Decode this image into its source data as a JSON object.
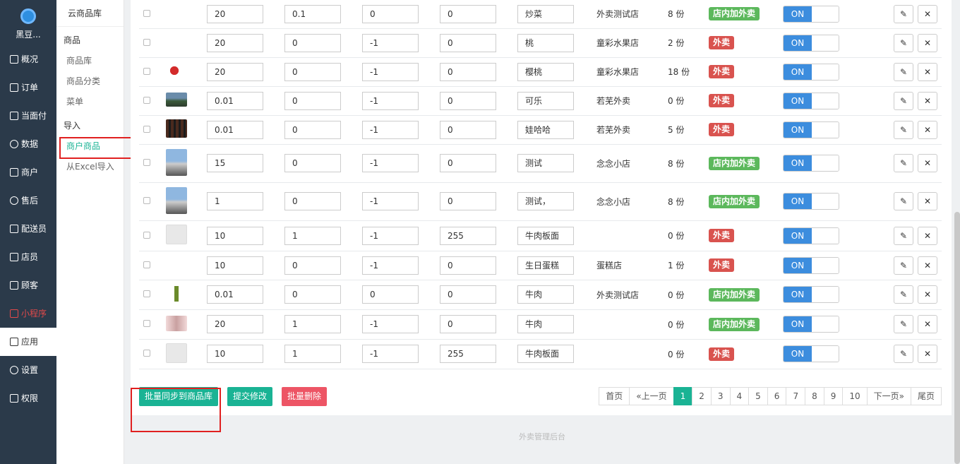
{
  "app": {
    "logo_text": "黑豆..."
  },
  "nav": [
    {
      "label": "概况",
      "icon": "dashboard-icon"
    },
    {
      "label": "订单",
      "icon": "order-icon"
    },
    {
      "label": "当面付",
      "icon": "pay-icon"
    },
    {
      "label": "数据",
      "icon": "data-icon"
    },
    {
      "label": "商户",
      "icon": "store-icon"
    },
    {
      "label": "售后",
      "icon": "aftersale-icon"
    },
    {
      "label": "配送员",
      "icon": "courier-icon"
    },
    {
      "label": "店员",
      "icon": "clerk-icon"
    },
    {
      "label": "顾客",
      "icon": "customer-icon"
    },
    {
      "label": "小程序",
      "icon": "miniprogram-icon"
    },
    {
      "label": "应用",
      "icon": "apps-icon"
    },
    {
      "label": "设置",
      "icon": "settings-icon"
    },
    {
      "label": "权限",
      "icon": "lock-icon"
    }
  ],
  "subnav": {
    "head": "云商品库",
    "group1": "商品",
    "items1": [
      "商品库",
      "商品分类",
      "菜单"
    ],
    "group2": "导入",
    "items2": [
      "商户商品",
      "从Excel导入"
    ]
  },
  "rows": [
    {
      "thumb": "",
      "v1": "20",
      "v2": "0.1",
      "v3": "0",
      "v4": "0",
      "name": "炒菜",
      "store": "外卖测试店",
      "qty": "8 份",
      "tag": "店内加外卖",
      "toggle": "ON"
    },
    {
      "thumb": "",
      "v1": "20",
      "v2": "0",
      "v3": "-1",
      "v4": "0",
      "name": "桃",
      "store": "童彩水果店",
      "qty": "2 份",
      "tag": "外卖",
      "toggle": "ON"
    },
    {
      "thumb": "cherry",
      "v1": "20",
      "v2": "0",
      "v3": "-1",
      "v4": "0",
      "name": "樱桃",
      "store": "童彩水果店",
      "qty": "18 份",
      "tag": "外卖",
      "toggle": "ON"
    },
    {
      "thumb": "landscape",
      "v1": "0.01",
      "v2": "0",
      "v3": "-1",
      "v4": "0",
      "name": "可乐",
      "store": "若芜外卖",
      "qty": "0 份",
      "tag": "外卖",
      "toggle": "ON"
    },
    {
      "thumb": "dark",
      "v1": "0.01",
      "v2": "0",
      "v3": "-1",
      "v4": "0",
      "name": "娃哈哈",
      "store": "若芜外卖",
      "qty": "5 份",
      "tag": "外卖",
      "toggle": "ON"
    },
    {
      "thumb": "city",
      "v1": "15",
      "v2": "0",
      "v3": "-1",
      "v4": "0",
      "name": "测试",
      "store": "念念小店",
      "qty": "8 份",
      "tag": "店内加外卖",
      "toggle": "ON"
    },
    {
      "thumb": "city",
      "v1": "1",
      "v2": "0",
      "v3": "-1",
      "v4": "0",
      "name": "测试，",
      "store": "念念小店",
      "qty": "8 份",
      "tag": "店内加外卖",
      "toggle": "ON"
    },
    {
      "thumb": "placeholder",
      "v1": "10",
      "v2": "1",
      "v3": "-1",
      "v4": "255",
      "name": "牛肉板面",
      "store": "",
      "qty": "0 份",
      "tag": "外卖",
      "toggle": "ON"
    },
    {
      "thumb": "",
      "v1": "10",
      "v2": "0",
      "v3": "-1",
      "v4": "0",
      "name": "生日蛋糕",
      "store": "蛋糕店",
      "qty": "1 份",
      "tag": "外卖",
      "toggle": "ON"
    },
    {
      "thumb": "bottle",
      "v1": "0.01",
      "v2": "0",
      "v3": "0",
      "v4": "0",
      "name": "牛肉",
      "store": "外卖测试店",
      "qty": "0 份",
      "tag": "店内加外卖",
      "toggle": "ON"
    },
    {
      "thumb": "food",
      "v1": "20",
      "v2": "1",
      "v3": "-1",
      "v4": "0",
      "name": "牛肉",
      "store": "",
      "qty": "0 份",
      "tag": "店内加外卖",
      "toggle": "ON"
    },
    {
      "thumb": "placeholder",
      "v1": "10",
      "v2": "1",
      "v3": "-1",
      "v4": "255",
      "name": "牛肉板面",
      "store": "",
      "qty": "0 份",
      "tag": "外卖",
      "toggle": "ON"
    }
  ],
  "actions": {
    "sync": "批量同步到商品库",
    "submit": "提交修改",
    "delete": "批量删除"
  },
  "pager": [
    "首页",
    "«上一页",
    "1",
    "2",
    "3",
    "4",
    "5",
    "6",
    "7",
    "8",
    "9",
    "10",
    "下一页»",
    "尾页"
  ],
  "pager_current": "1",
  "footer": "外卖管理后台",
  "colors": {
    "accent": "#1ab394",
    "red": "#d9534f",
    "green": "#5cb85c",
    "blue": "#3c8dde",
    "sidebar": "#2b3a4a"
  }
}
